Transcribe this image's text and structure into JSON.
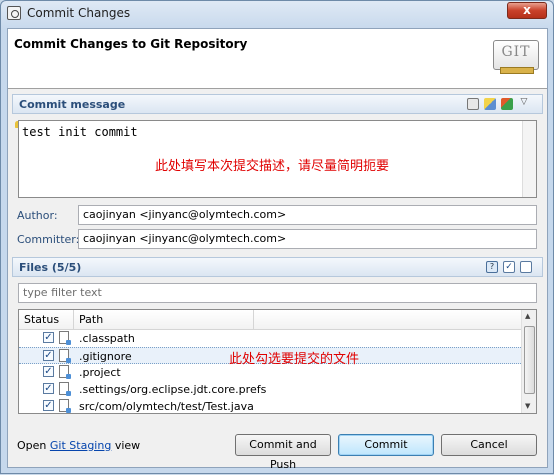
{
  "window": {
    "title": "Commit Changes",
    "close_label": "x"
  },
  "banner": {
    "title": "Commit Changes to Git Repository",
    "logo_text": "GIT"
  },
  "commit_section": {
    "title": "Commit message",
    "message": "test init commit",
    "annotation": "此处填写本次提交描述，请尽量简明扼要",
    "toolbar_icons": [
      "spell-check-icon",
      "edit-icon",
      "signed-off-icon",
      "dropdown-menu-icon"
    ]
  },
  "author": {
    "label": "Author:",
    "value": "caojinyan <jinyanc@olymtech.com>"
  },
  "committer": {
    "label": "Committer:",
    "value": "caojinyan <jinyanc@olymtech.com>"
  },
  "files": {
    "title": "Files (5/5)",
    "filter_placeholder": "type filter text",
    "columns": [
      "Status",
      "Path"
    ],
    "annotation": "此处勾选要提交的文件",
    "rows": [
      {
        "checked": true,
        "path": ".classpath",
        "icon": "untracked-file-icon"
      },
      {
        "checked": true,
        "path": ".gitignore",
        "icon": "untracked-file-icon"
      },
      {
        "checked": true,
        "path": ".project",
        "icon": "untracked-file-icon"
      },
      {
        "checked": true,
        "path": ".settings/org.eclipse.jdt.core.prefs",
        "icon": "untracked-file-icon"
      },
      {
        "checked": true,
        "path": "src/com/olymtech/test/Test.java",
        "icon": "untracked-file-icon"
      }
    ],
    "selected_index": 1
  },
  "footer": {
    "open_prefix": "Open",
    "staging_link": "Git Staging",
    "open_suffix": "view",
    "buttons": {
      "commit_push": "Commit and Push",
      "commit": "Commit",
      "cancel": "Cancel"
    }
  }
}
